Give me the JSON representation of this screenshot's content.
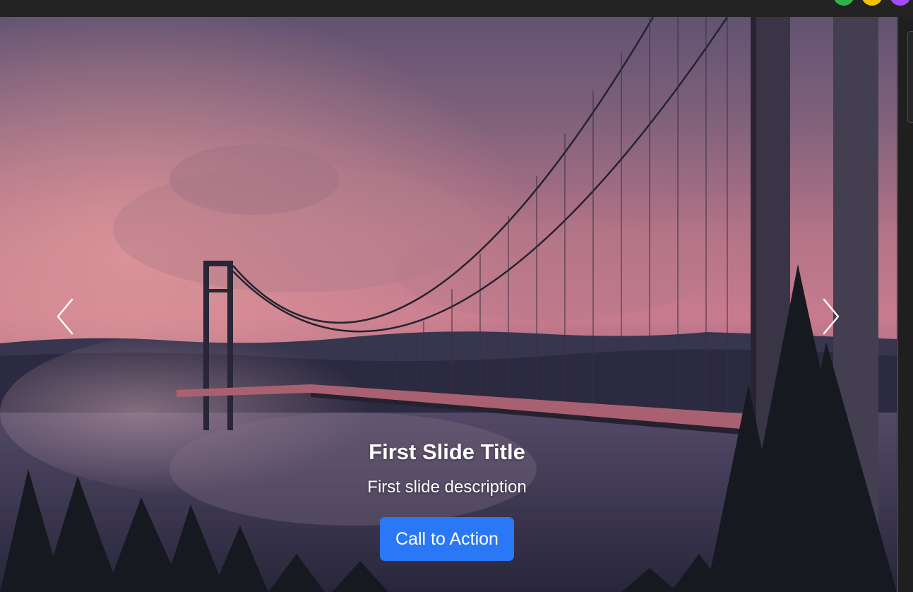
{
  "window": {
    "title": "",
    "indicators": [
      {
        "name": "green",
        "color": "#2fb24c"
      },
      {
        "name": "yellow",
        "color": "#f2c200"
      },
      {
        "name": "purple",
        "color": "#a24cf5"
      }
    ]
  },
  "carousel": {
    "slide": {
      "title": "First Slide Title",
      "description": "First slide description",
      "cta_label": "Call to Action"
    },
    "prev_icon": "chevron-left-icon",
    "next_icon": "chevron-right-icon"
  },
  "colors": {
    "cta": "#2a78f5",
    "sky_top": "#6a5a7c",
    "sky_mid": "#d9869a"
  }
}
